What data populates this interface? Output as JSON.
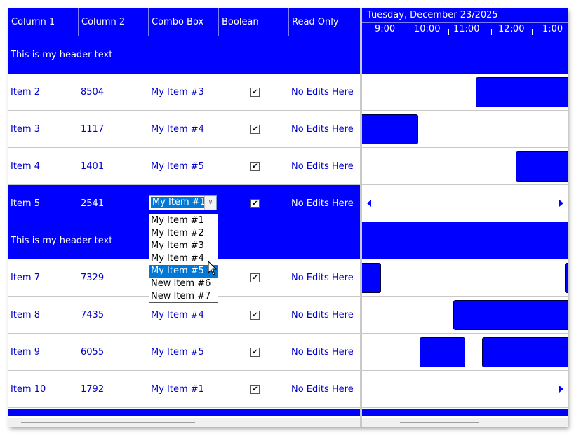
{
  "columns": [
    "Column 1",
    "Column 2",
    "Combo Box",
    "Boolean",
    "Read Only"
  ],
  "rows": [
    {
      "type": "group",
      "text": "This is my header text"
    },
    {
      "type": "data",
      "c1": "Item 2",
      "c2": "8504",
      "c3": "My Item #3",
      "checked": true,
      "c5": "No Edits Here"
    },
    {
      "type": "data",
      "c1": "Item 3",
      "c2": "1117",
      "c3": "My Item #4",
      "checked": true,
      "c5": "No Edits Here"
    },
    {
      "type": "data",
      "c1": "Item 4",
      "c2": "1401",
      "c3": "My Item #5",
      "checked": true,
      "c5": "No Edits Here"
    },
    {
      "type": "selected",
      "c1": "Item 5",
      "c2": "2541",
      "c3": "My Item #1",
      "checked": true,
      "c5": "No Edits Here"
    },
    {
      "type": "group",
      "text": "This is my header text"
    },
    {
      "type": "data",
      "c1": "Item 7",
      "c2": "7329",
      "c3": "",
      "checked": true,
      "c5": "No Edits Here"
    },
    {
      "type": "data",
      "c1": "Item 8",
      "c2": "7435",
      "c3": "My Item #4",
      "checked": true,
      "c5": "No Edits Here"
    },
    {
      "type": "data",
      "c1": "Item 9",
      "c2": "6055",
      "c3": "My Item #5",
      "checked": true,
      "c5": "No Edits Here"
    },
    {
      "type": "data",
      "c1": "Item 10",
      "c2": "1792",
      "c3": "My Item #1",
      "checked": true,
      "c5": "No Edits Here"
    }
  ],
  "combo": {
    "value": "My Item #1",
    "options": [
      "My Item #1",
      "My Item #2",
      "My Item #3",
      "My Item #4",
      "My Item #5",
      "New Item #6",
      "New Item #7"
    ],
    "highlighted": "My Item #5"
  },
  "timeline": {
    "date": "Tuesday, December 23/2025",
    "hours": [
      "9:00",
      "10:00",
      "11:00",
      "12:00",
      "1:00"
    ]
  },
  "colors": {
    "accent": "#0000ff",
    "text": "#0000cc",
    "highlight": "#0078d7"
  }
}
